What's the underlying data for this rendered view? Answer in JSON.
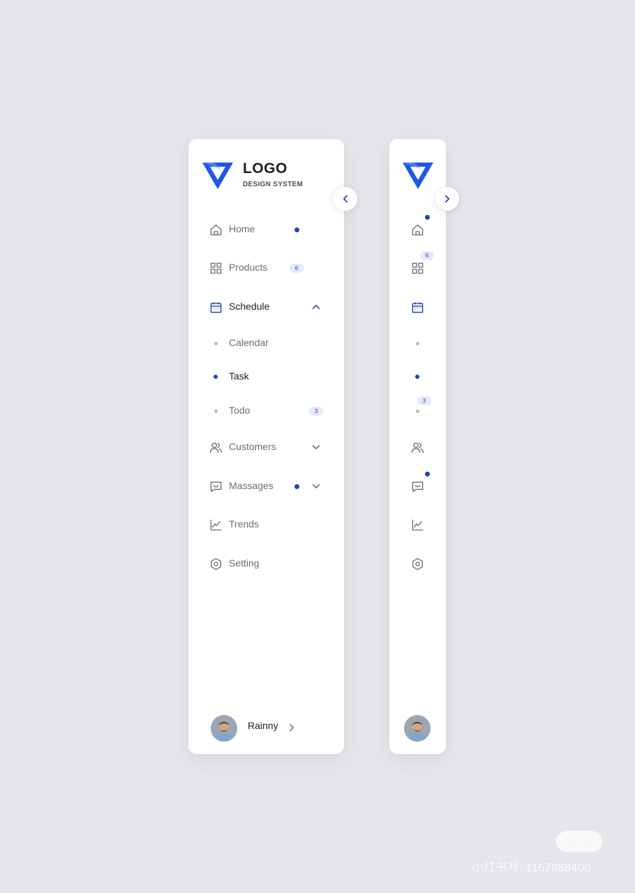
{
  "brand": {
    "title": "LOGO",
    "subtitle": "DESIGN SYSTEM",
    "color": "#1f57e7"
  },
  "accent": "#2043b6",
  "nav": {
    "home": {
      "label": "Home",
      "icon": "home-icon",
      "has_dot": true
    },
    "products": {
      "label": "Products",
      "icon": "grid-icon",
      "badge": "6"
    },
    "schedule": {
      "label": "Schedule",
      "icon": "calendar-icon",
      "expanded": true,
      "children": {
        "calendar": {
          "label": "Calendar"
        },
        "task": {
          "label": "Task",
          "active": true
        },
        "todo": {
          "label": "Todo",
          "badge": "3"
        }
      }
    },
    "customers": {
      "label": "Customers",
      "icon": "users-icon"
    },
    "massages": {
      "label": "Massages",
      "icon": "message-icon",
      "has_dot": true
    },
    "trends": {
      "label": "Trends",
      "icon": "chart-icon"
    },
    "setting": {
      "label": "Setting",
      "icon": "gear-icon"
    }
  },
  "user": {
    "name": "Rainny"
  },
  "watermark": {
    "logo": "小红书",
    "text": "小红书号: 1167888400"
  }
}
